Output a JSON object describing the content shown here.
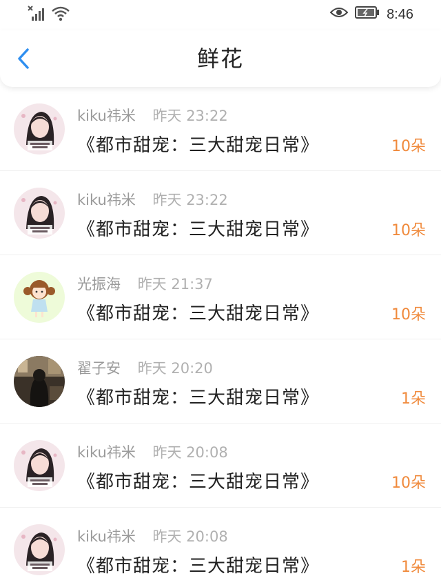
{
  "status_bar": {
    "time": "8:46"
  },
  "header": {
    "title": "鲜花"
  },
  "colors": {
    "accent_blue": "#2f8ff0",
    "amount_orange": "#f08a3c"
  },
  "items": [
    {
      "name": "kiku祎米",
      "time": "昨天 23:22",
      "book": "《都市甜宠：三大甜宠日常》",
      "amount": "10朵",
      "avatar": "portrait-avatar"
    },
    {
      "name": "kiku祎米",
      "time": "昨天 23:22",
      "book": "《都市甜宠：三大甜宠日常》",
      "amount": "10朵",
      "avatar": "portrait-avatar"
    },
    {
      "name": "光振海",
      "time": "昨天 21:37",
      "book": "《都市甜宠：三大甜宠日常》",
      "amount": "10朵",
      "avatar": "cartoon-girl-avatar"
    },
    {
      "name": "翟子安",
      "time": "昨天 20:20",
      "book": "《都市甜宠：三大甜宠日常》",
      "amount": "1朵",
      "avatar": "dark-photo-avatar"
    },
    {
      "name": "kiku祎米",
      "time": "昨天 20:08",
      "book": "《都市甜宠：三大甜宠日常》",
      "amount": "10朵",
      "avatar": "portrait-avatar"
    },
    {
      "name": "kiku祎米",
      "time": "昨天 20:08",
      "book": "《都市甜宠：三大甜宠日常》",
      "amount": "1朵",
      "avatar": "portrait-avatar"
    }
  ]
}
